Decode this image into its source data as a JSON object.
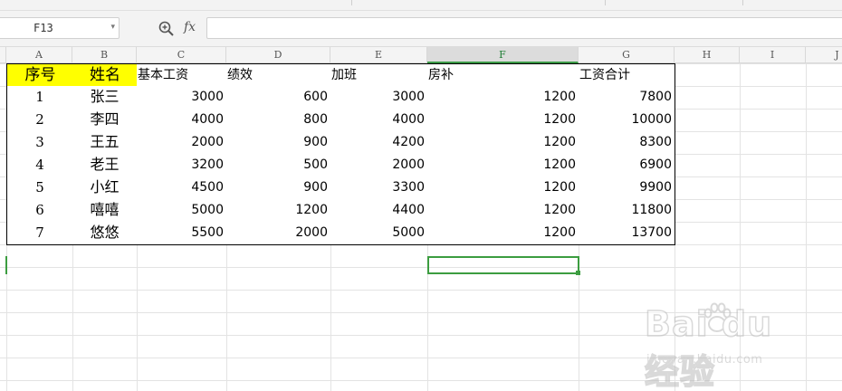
{
  "formula_bar": {
    "name_box_value": "F13",
    "fx_label": "fx",
    "formula_value": ""
  },
  "column_headers": [
    "A",
    "B",
    "C",
    "D",
    "E",
    "F",
    "G",
    "H",
    "I",
    "J"
  ],
  "active_column": "F",
  "selected_cell": "F13",
  "table": {
    "headers": [
      "序号",
      "姓名",
      "基本工资",
      "绩效",
      "加班",
      "房补",
      "工资合计"
    ],
    "rows": [
      [
        "1",
        "张三",
        "3000",
        "600",
        "3000",
        "1200",
        "7800"
      ],
      [
        "2",
        "李四",
        "4000",
        "800",
        "4000",
        "1200",
        "10000"
      ],
      [
        "3",
        "王五",
        "2000",
        "900",
        "4200",
        "1200",
        "8300"
      ],
      [
        "4",
        "老王",
        "3200",
        "500",
        "2000",
        "1200",
        "6900"
      ],
      [
        "5",
        "小红",
        "4500",
        "900",
        "3300",
        "1200",
        "9900"
      ],
      [
        "6",
        "嘻嘻",
        "5000",
        "1200",
        "4400",
        "1200",
        "11800"
      ],
      [
        "7",
        "悠悠",
        "5500",
        "2000",
        "5000",
        "1200",
        "13700"
      ]
    ]
  },
  "colors": {
    "header_highlight": "#ffff00",
    "selection": "#3c9d40"
  },
  "watermark": {
    "text": "Bai du 经验",
    "url": "jingyan.baidu.com"
  }
}
